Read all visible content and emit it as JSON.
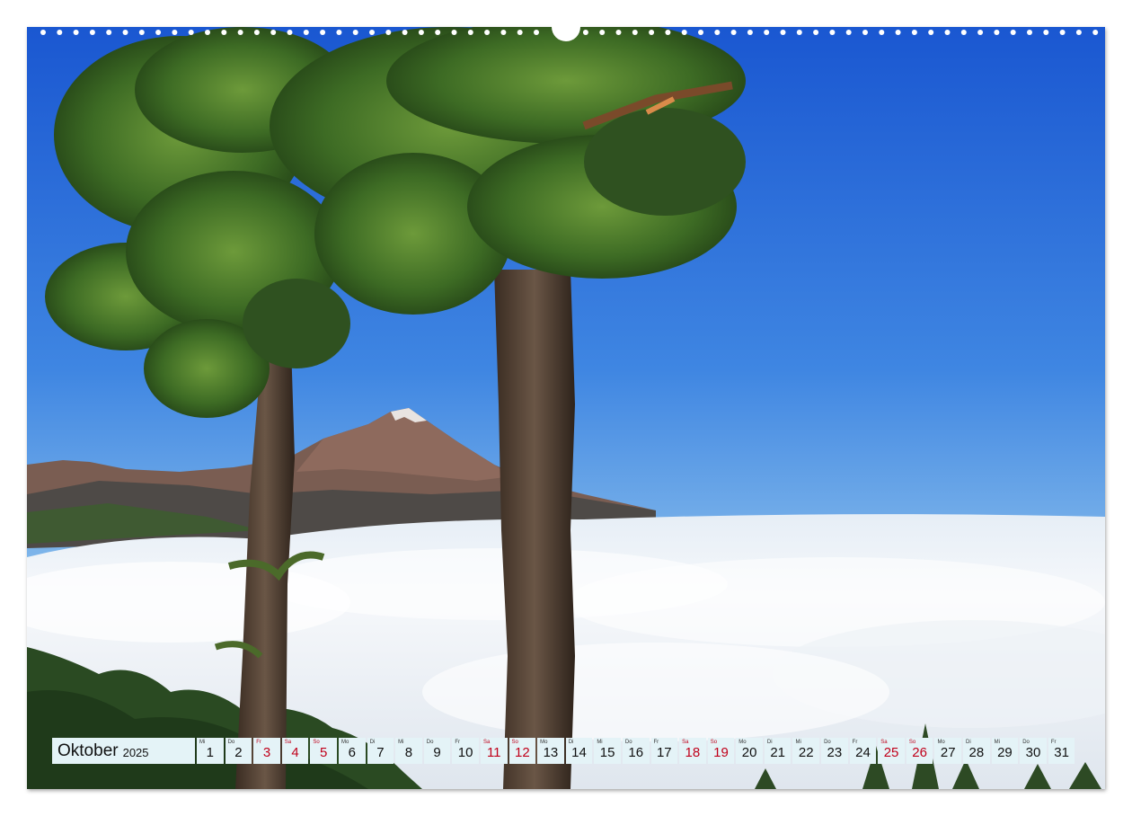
{
  "calendar": {
    "month": "Oktober",
    "year": "2025",
    "days": [
      {
        "wd": "Mi",
        "n": "1",
        "weekend": false
      },
      {
        "wd": "Do",
        "n": "2",
        "weekend": false
      },
      {
        "wd": "Fr",
        "n": "3",
        "weekend": true
      },
      {
        "wd": "Sa",
        "n": "4",
        "weekend": true
      },
      {
        "wd": "So",
        "n": "5",
        "weekend": true
      },
      {
        "wd": "Mo",
        "n": "6",
        "weekend": false
      },
      {
        "wd": "Di",
        "n": "7",
        "weekend": false
      },
      {
        "wd": "Mi",
        "n": "8",
        "weekend": false
      },
      {
        "wd": "Do",
        "n": "9",
        "weekend": false
      },
      {
        "wd": "Fr",
        "n": "10",
        "weekend": false
      },
      {
        "wd": "Sa",
        "n": "11",
        "weekend": true
      },
      {
        "wd": "So",
        "n": "12",
        "weekend": true
      },
      {
        "wd": "Mo",
        "n": "13",
        "weekend": false
      },
      {
        "wd": "Di",
        "n": "14",
        "weekend": false
      },
      {
        "wd": "Mi",
        "n": "15",
        "weekend": false
      },
      {
        "wd": "Do",
        "n": "16",
        "weekend": false
      },
      {
        "wd": "Fr",
        "n": "17",
        "weekend": false
      },
      {
        "wd": "Sa",
        "n": "18",
        "weekend": true
      },
      {
        "wd": "So",
        "n": "19",
        "weekend": true
      },
      {
        "wd": "Mo",
        "n": "20",
        "weekend": false
      },
      {
        "wd": "Di",
        "n": "21",
        "weekend": false
      },
      {
        "wd": "Mi",
        "n": "22",
        "weekend": false
      },
      {
        "wd": "Do",
        "n": "23",
        "weekend": false
      },
      {
        "wd": "Fr",
        "n": "24",
        "weekend": false
      },
      {
        "wd": "Sa",
        "n": "25",
        "weekend": true
      },
      {
        "wd": "So",
        "n": "26",
        "weekend": true
      },
      {
        "wd": "Mo",
        "n": "27",
        "weekend": false
      },
      {
        "wd": "Di",
        "n": "28",
        "weekend": false
      },
      {
        "wd": "Mi",
        "n": "29",
        "weekend": false
      },
      {
        "wd": "Do",
        "n": "30",
        "weekend": false
      },
      {
        "wd": "Fr",
        "n": "31",
        "weekend": false
      }
    ]
  },
  "colors": {
    "sky_top": "#1f5fd6",
    "sky_bottom": "#9ccbee",
    "cloud": "#f4f7fa",
    "weekend_text": "#c0001a",
    "calendar_bg": "#e4f3f7"
  }
}
